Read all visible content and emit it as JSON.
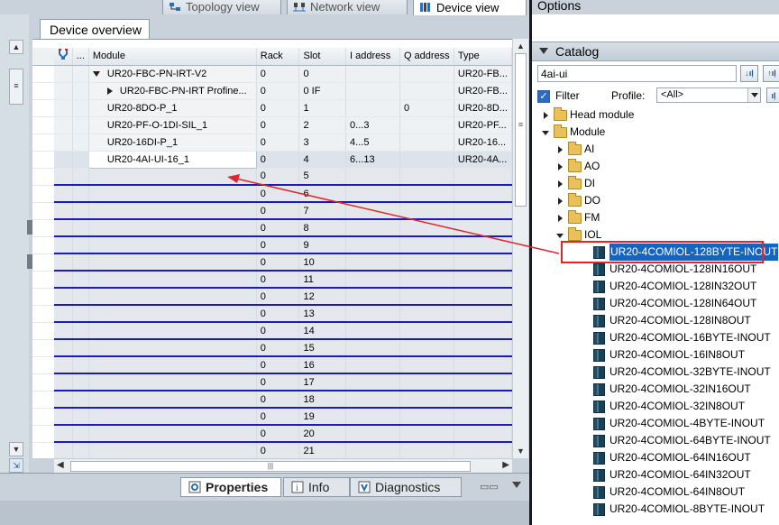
{
  "top_tabs": [
    {
      "label": "Topology view",
      "active": false
    },
    {
      "label": "Network view",
      "active": false
    },
    {
      "label": "Device view",
      "active": true
    }
  ],
  "device_overview": {
    "title": "Device overview",
    "columns": [
      "",
      "...",
      "Module",
      "Rack",
      "Slot",
      "I address",
      "Q address",
      "Type"
    ],
    "rows": [
      {
        "module": "UR20-FBC-PN-IRT-V2",
        "rack": "0",
        "slot": "0",
        "iaddr": "",
        "qaddr": "",
        "type": "UR20-FB...",
        "expand": "down",
        "indent": 1
      },
      {
        "module": "UR20-FBC-PN-IRT Profine...",
        "rack": "0",
        "slot": "0 IF",
        "iaddr": "",
        "qaddr": "",
        "type": "UR20-FB...",
        "expand": "right",
        "indent": 2
      },
      {
        "module": "UR20-8DO-P_1",
        "rack": "0",
        "slot": "1",
        "iaddr": "",
        "qaddr": "0",
        "type": "UR20-8D...",
        "expand": "",
        "indent": 0
      },
      {
        "module": "UR20-PF-O-1DI-SIL_1",
        "rack": "0",
        "slot": "2",
        "iaddr": "0...3",
        "qaddr": "",
        "type": "UR20-PF...",
        "expand": "",
        "indent": 0
      },
      {
        "module": "UR20-16DI-P_1",
        "rack": "0",
        "slot": "3",
        "iaddr": "4...5",
        "qaddr": "",
        "type": "UR20-16...",
        "expand": "",
        "indent": 0
      },
      {
        "module": "UR20-4AI-UI-16_1",
        "rack": "0",
        "slot": "4",
        "iaddr": "6...13",
        "qaddr": "",
        "type": "UR20-4A...",
        "expand": "",
        "indent": 0
      }
    ],
    "empty_slots": [
      "5",
      "6",
      "7",
      "8",
      "9",
      "10",
      "11",
      "12",
      "13",
      "14",
      "15",
      "16",
      "17",
      "18",
      "19",
      "20",
      "21"
    ],
    "empty_rack": "0"
  },
  "bottom_tabs": [
    {
      "label": "Properties",
      "active": true
    },
    {
      "label": "Info",
      "active": false
    },
    {
      "label": "Diagnostics",
      "active": false
    }
  ],
  "options": {
    "title": "Options",
    "catalog_title": "Catalog",
    "search_value": "4ai-ui",
    "filter_label": "Filter",
    "profile_label": "Profile:",
    "profile_value": "<All>",
    "tree": [
      {
        "label": "Head module",
        "level": 0,
        "expand": "right",
        "icon": "folder"
      },
      {
        "label": "Module",
        "level": 0,
        "expand": "down",
        "icon": "folder"
      },
      {
        "label": "AI",
        "level": 1,
        "expand": "right",
        "icon": "folder"
      },
      {
        "label": "AO",
        "level": 1,
        "expand": "right",
        "icon": "folder"
      },
      {
        "label": "DI",
        "level": 1,
        "expand": "right",
        "icon": "folder"
      },
      {
        "label": "DO",
        "level": 1,
        "expand": "right",
        "icon": "folder"
      },
      {
        "label": "FM",
        "level": 1,
        "expand": "right",
        "icon": "folder"
      },
      {
        "label": "IOL",
        "level": 1,
        "expand": "down",
        "icon": "folder"
      },
      {
        "label": "UR20-4COMIOL-128BYTE-INOUT",
        "level": 2,
        "expand": "",
        "icon": "module",
        "highlighted": true
      },
      {
        "label": "UR20-4COMIOL-128IN16OUT",
        "level": 2,
        "expand": "",
        "icon": "module"
      },
      {
        "label": "UR20-4COMIOL-128IN32OUT",
        "level": 2,
        "expand": "",
        "icon": "module"
      },
      {
        "label": "UR20-4COMIOL-128IN64OUT",
        "level": 2,
        "expand": "",
        "icon": "module"
      },
      {
        "label": "UR20-4COMIOL-128IN8OUT",
        "level": 2,
        "expand": "",
        "icon": "module"
      },
      {
        "label": "UR20-4COMIOL-16BYTE-INOUT",
        "level": 2,
        "expand": "",
        "icon": "module"
      },
      {
        "label": "UR20-4COMIOL-16IN8OUT",
        "level": 2,
        "expand": "",
        "icon": "module"
      },
      {
        "label": "UR20-4COMIOL-32BYTE-INOUT",
        "level": 2,
        "expand": "",
        "icon": "module"
      },
      {
        "label": "UR20-4COMIOL-32IN16OUT",
        "level": 2,
        "expand": "",
        "icon": "module"
      },
      {
        "label": "UR20-4COMIOL-32IN8OUT",
        "level": 2,
        "expand": "",
        "icon": "module"
      },
      {
        "label": "UR20-4COMIOL-4BYTE-INOUT",
        "level": 2,
        "expand": "",
        "icon": "module"
      },
      {
        "label": "UR20-4COMIOL-64BYTE-INOUT",
        "level": 2,
        "expand": "",
        "icon": "module"
      },
      {
        "label": "UR20-4COMIOL-64IN16OUT",
        "level": 2,
        "expand": "",
        "icon": "module"
      },
      {
        "label": "UR20-4COMIOL-64IN32OUT",
        "level": 2,
        "expand": "",
        "icon": "module"
      },
      {
        "label": "UR20-4COMIOL-64IN8OUT",
        "level": 2,
        "expand": "",
        "icon": "module"
      },
      {
        "label": "UR20-4COMIOL-8BYTE-INOUT",
        "level": 2,
        "expand": "",
        "icon": "module"
      }
    ]
  },
  "colors": {
    "highlight": "#1565c0",
    "annotation": "#e0262b",
    "slot_line": "#1b1bb8"
  }
}
